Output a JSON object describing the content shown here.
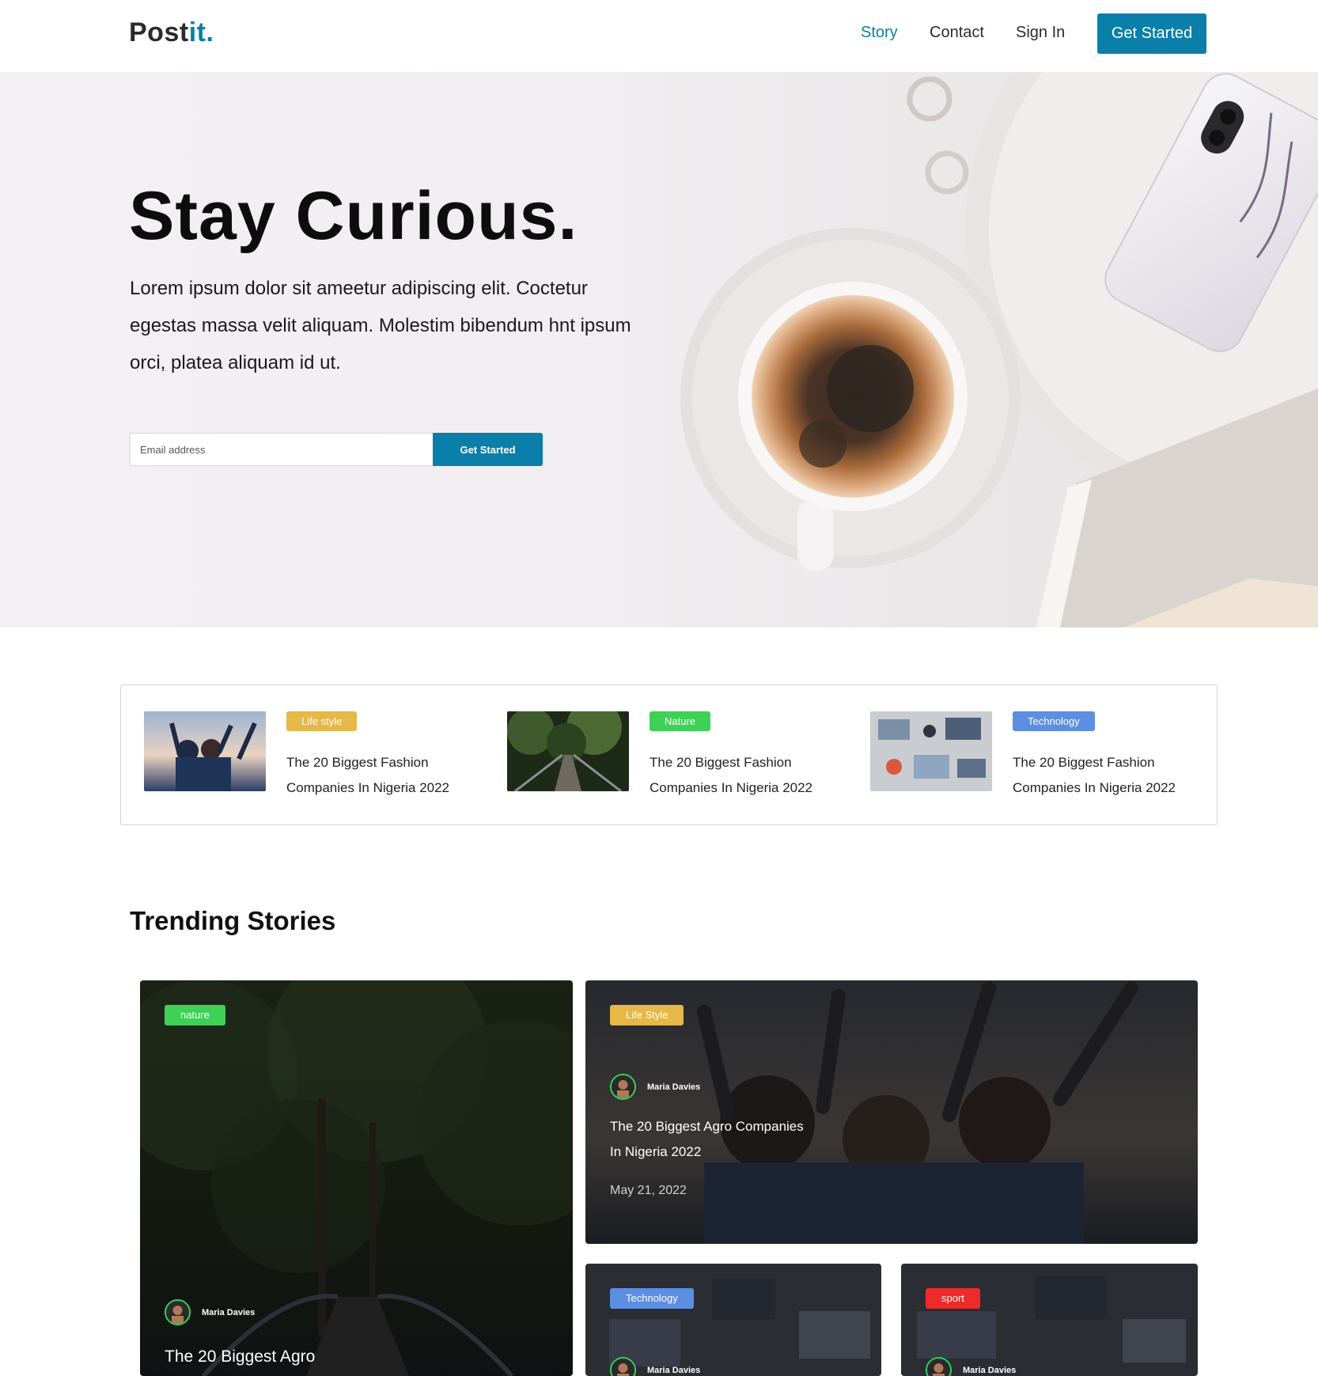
{
  "nav": {
    "logo_main": "Post",
    "logo_accent": "it.",
    "links": [
      "Story",
      "Contact",
      "Sign In"
    ],
    "cta": "Get Started"
  },
  "hero": {
    "title": "Stay Curious.",
    "text": "Lorem ipsum dolor sit ameetur adipiscing elit. Coctetur egestas massa velit aliquam. Molestim bibendum hnt ipsum orci, platea aliquam id ut.",
    "input_placeholder": "Email address",
    "button": "Get Started"
  },
  "featured": [
    {
      "category": "Life style",
      "title": "The 20 Biggest Fashion Companies In Nigeria 2022",
      "badge_color": "#e5b847"
    },
    {
      "category": "Nature",
      "title": "The 20 Biggest Fashion Companies In Nigeria 2022",
      "badge_color": "#3fd156"
    },
    {
      "category": "Technology",
      "title": "The 20 Biggest Fashion Companies In Nigeria 2022",
      "badge_color": "#5c8fe3"
    }
  ],
  "trending": {
    "title": "Trending Stories",
    "cards": [
      {
        "category": "nature",
        "badge_color": "#3fd156",
        "author": "Maria Davies",
        "title": "The 20 Biggest Agro"
      },
      {
        "category": "Life Style",
        "badge_color": "#e5b847",
        "author": "Maria Davies",
        "title": "The 20 Biggest Agro Companies In Nigeria 2022",
        "date": "May 21, 2022"
      },
      {
        "category": "Technology",
        "badge_color": "#5c8fe3",
        "author": "Maria Davies"
      },
      {
        "category": "sport",
        "badge_color": "#ee2a2a",
        "author": "Maria Davies"
      }
    ]
  },
  "colors": {
    "accent": "#0a7fa9"
  }
}
